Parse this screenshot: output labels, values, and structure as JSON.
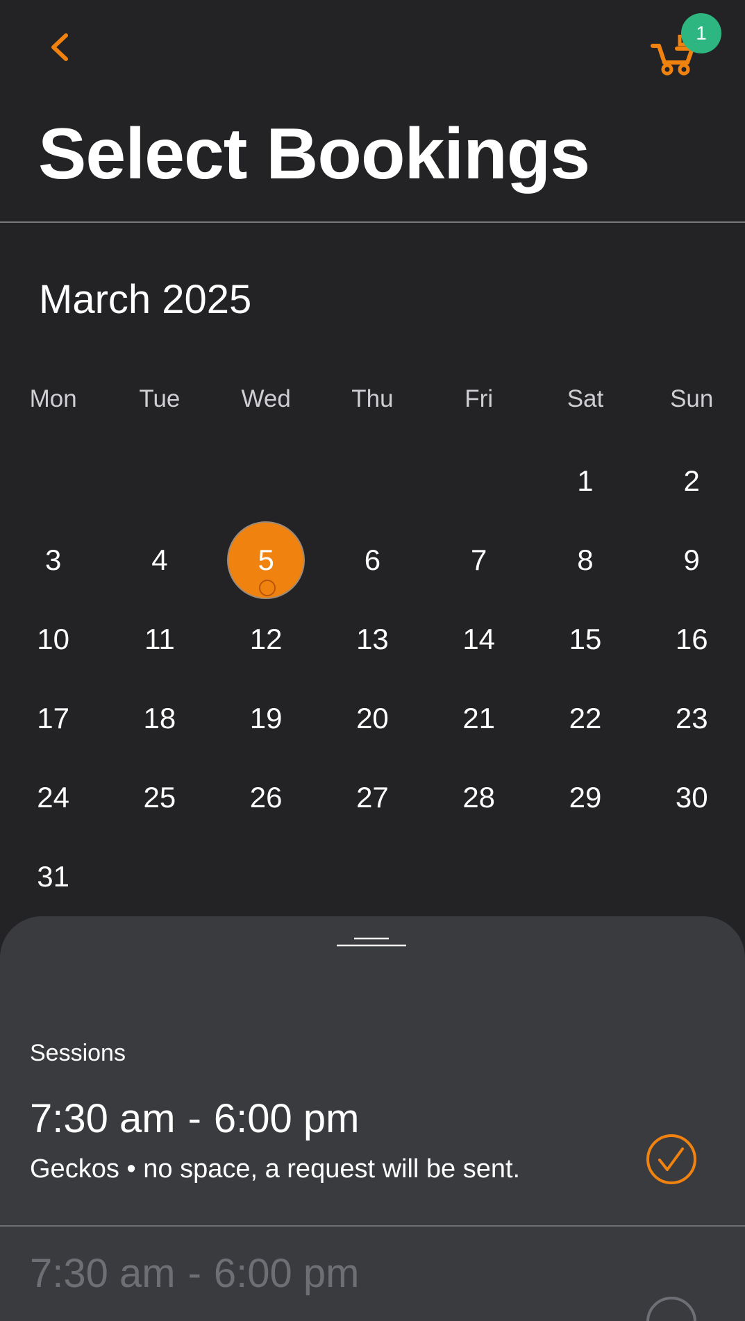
{
  "header": {
    "title": "Select Bookings",
    "cart_count": "1"
  },
  "calendar": {
    "month_label": "March 2025",
    "weekdays": [
      "Mon",
      "Tue",
      "Wed",
      "Thu",
      "Fri",
      "Sat",
      "Sun"
    ],
    "weeks": [
      [
        "",
        "",
        "",
        "",
        "",
        "1",
        "2"
      ],
      [
        "3",
        "4",
        "5",
        "6",
        "7",
        "8",
        "9"
      ],
      [
        "10",
        "11",
        "12",
        "13",
        "14",
        "15",
        "16"
      ],
      [
        "17",
        "18",
        "19",
        "20",
        "21",
        "22",
        "23"
      ],
      [
        "24",
        "25",
        "26",
        "27",
        "28",
        "29",
        "30"
      ],
      [
        "31",
        "",
        "",
        "",
        "",
        "",
        ""
      ]
    ],
    "selected_day": "5"
  },
  "sessions": {
    "label": "Sessions",
    "items": [
      {
        "start": "7:30 am",
        "separator": "-",
        "end": "6:00 pm",
        "description": "Geckos • no space, a request will be sent.",
        "selected": true
      },
      {
        "start": "7:30 am",
        "separator": "-",
        "end": "6:00 pm",
        "description": "",
        "selected": false
      }
    ]
  },
  "colors": {
    "accent": "#f0820f",
    "badge": "#2eb680",
    "background": "#232325",
    "sheet": "#3a3b3f"
  }
}
